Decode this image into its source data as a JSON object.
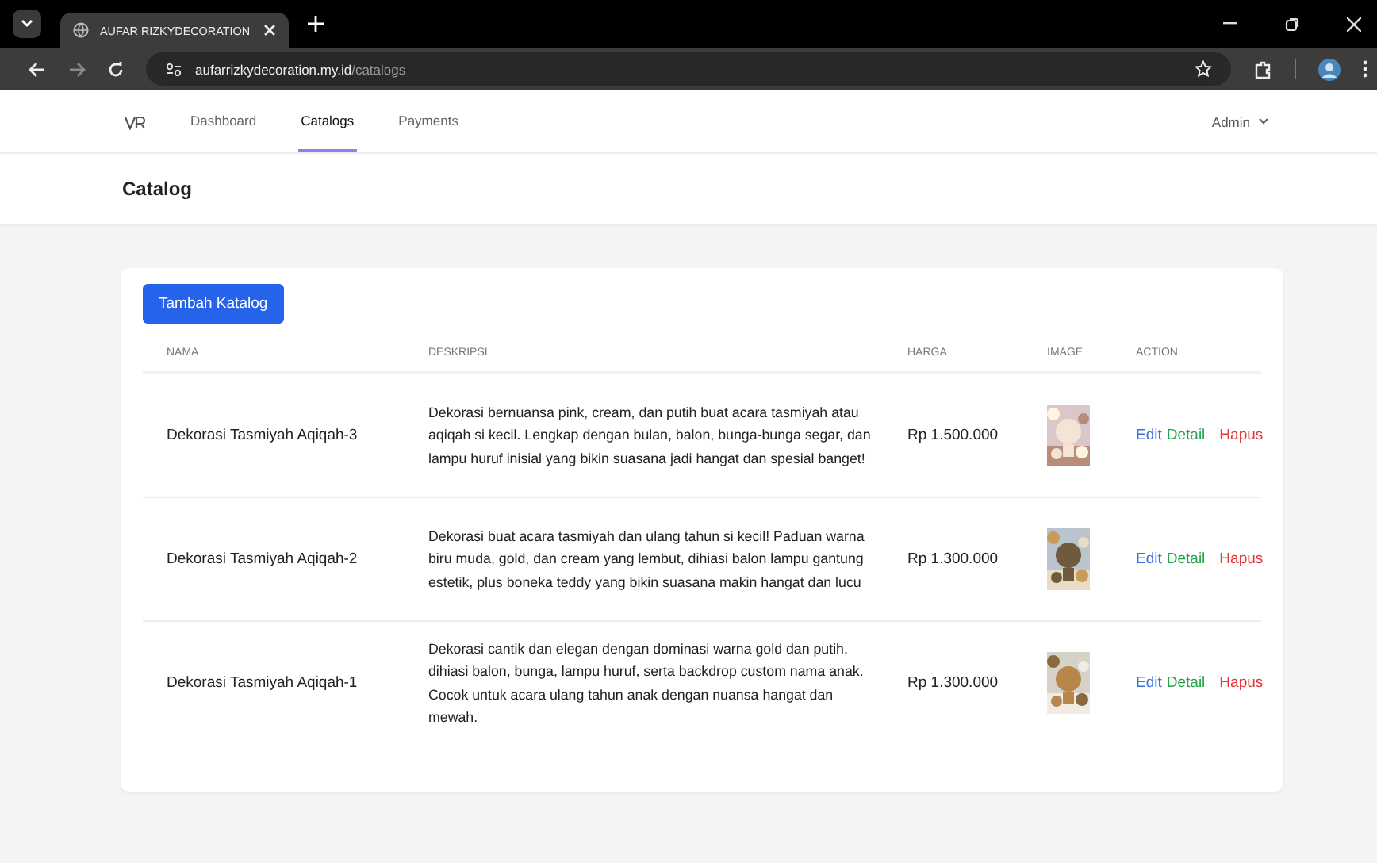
{
  "browser": {
    "tab_title": "AUFAR RIZKYDECORATION",
    "url_host": "aufarrizkydecoration.my.id",
    "url_path": "/catalogs"
  },
  "nav": {
    "items": [
      {
        "label": "Dashboard",
        "selected": false
      },
      {
        "label": "Catalogs",
        "selected": true
      },
      {
        "label": "Payments",
        "selected": false
      }
    ],
    "user": "Admin"
  },
  "page_title": "Catalog",
  "add_button": "Tambah Katalog",
  "table": {
    "columns": [
      "NAMA",
      "DESKRIPSI",
      "HARGA",
      "IMAGE",
      "ACTION"
    ],
    "rows": [
      {
        "nama": "Dekorasi Tasmiyah Aqiqah-3",
        "deskripsi": "Dekorasi bernuansa pink, cream, dan putih buat acara tasmiyah atau aqiqah si kecil. Lengkap dengan bulan, balon, bunga-bunga segar, dan lampu huruf inisial yang bikin suasana jadi hangat dan spesial banget!",
        "harga": "Rp 1.500.000",
        "actions": [
          {
            "label": "Edit",
            "kind": "edit"
          },
          {
            "label": "Detail",
            "kind": "detail"
          },
          {
            "label": "Hapus",
            "kind": "delete"
          }
        ]
      },
      {
        "nama": "Dekorasi Tasmiyah Aqiqah-2",
        "deskripsi": "Dekorasi buat acara tasmiyah dan ulang tahun si kecil! Paduan warna biru muda, gold, dan cream yang lembut, dihiasi balon lampu gantung estetik, plus boneka teddy yang bikin suasana makin hangat dan lucu",
        "harga": "Rp 1.300.000",
        "actions": [
          {
            "label": "Edit",
            "kind": "edit"
          },
          {
            "label": "Detail",
            "kind": "detail"
          },
          {
            "label": "Hapus",
            "kind": "delete"
          }
        ]
      },
      {
        "nama": "Dekorasi Tasmiyah Aqiqah-1",
        "deskripsi": "Dekorasi cantik dan elegan dengan dominasi warna gold dan putih, dihiasi balon, bunga, lampu huruf, serta backdrop custom nama anak. Cocok untuk acara ulang tahun anak dengan nuansa hangat dan mewah.",
        "harga": "Rp 1.300.000",
        "actions": [
          {
            "label": "Edit",
            "kind": "edit"
          },
          {
            "label": "Detail",
            "kind": "detail"
          },
          {
            "label": "Hapus",
            "kind": "delete"
          }
        ]
      }
    ]
  }
}
